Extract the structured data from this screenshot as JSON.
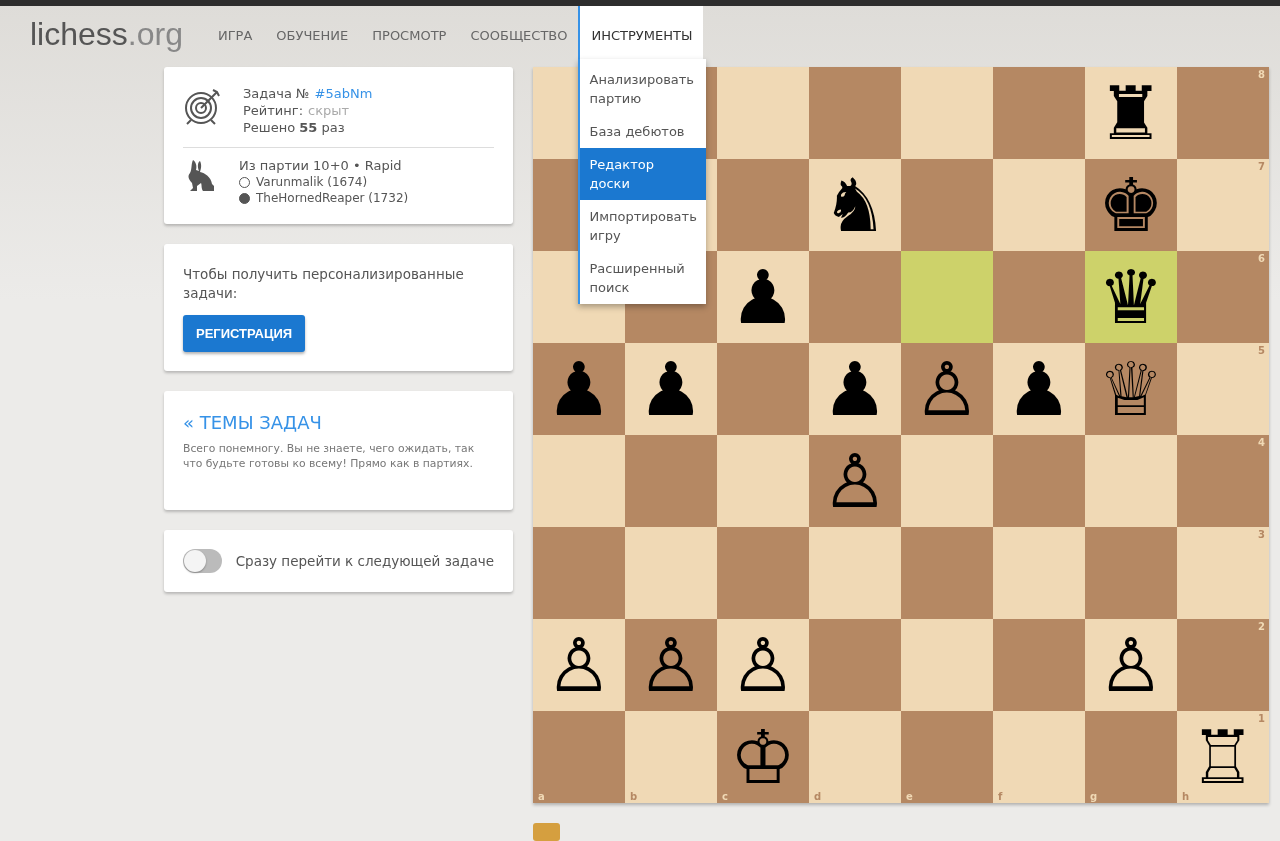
{
  "header": {
    "logo": {
      "name": "lichess",
      "suffix": ".org"
    },
    "nav": [
      {
        "label": "ИГРА",
        "selected": false
      },
      {
        "label": "ОБУЧЕНИЕ",
        "selected": false
      },
      {
        "label": "ПРОСМОТР",
        "selected": false
      },
      {
        "label": "СООБЩЕСТВО",
        "selected": false
      },
      {
        "label": "ИНСТРУМЕНТЫ",
        "selected": true
      }
    ],
    "menu": [
      {
        "label": "Анализировать партию",
        "selected": false
      },
      {
        "label": "База дебютов",
        "selected": false
      },
      {
        "label": "Редактор доски",
        "selected": true
      },
      {
        "label": "Импортировать игру",
        "selected": false
      },
      {
        "label": "Расширенный поиск",
        "selected": false
      }
    ]
  },
  "puzzle": {
    "title": "Задача №",
    "id": "#5abNm",
    "rating_label": "Рейтинг:",
    "rating": "скрыт",
    "solved": "Решено **55** раз",
    "game": "Из партии 10+0 • Rapid",
    "players": [
      {
        "name": "Varunmalik (1674)",
        "kind": "white"
      },
      {
        "name": "TheHornedReaper (1732)",
        "kind": "black"
      }
    ]
  },
  "signup": {
    "text": "Чтобы получить персонализированные задачи:",
    "button": "РЕГИСТРАЦИЯ"
  },
  "themes": {
    "link": "« ТЕМЫ ЗАДАЧ",
    "text": "Всего понемногу. Вы не знаете, чего ожидать, так что будьте готовы ко всему! Прямо как в партиях."
  },
  "auto_next": {
    "label": "Сразу перейти к следующей задаче",
    "on": false
  },
  "board": {
    "files": [
      "a",
      "b",
      "c",
      "d",
      "e",
      "f",
      "g",
      "h"
    ],
    "ranks": [
      "8",
      "7",
      "6",
      "5",
      "4",
      "3",
      "2",
      "1"
    ],
    "rows": [
      [
        {
          "highlighted": false
        },
        {},
        {
          "highlighted": false
        },
        {
          "highlighted": false
        },
        {
          "highlighted": false
        },
        {
          "highlighted": false
        },
        {
          "piece": "♜",
          "highlighted": false
        },
        {
          "highlighted": false
        }
      ],
      [
        {
          "highlighted": false
        },
        {},
        {
          "highlighted": false
        },
        {
          "piece": "♞",
          "highlighted": false
        },
        {
          "highlighted": false
        },
        {
          "highlighted": false
        },
        {
          "piece": "♚",
          "highlighted": false
        },
        {
          "highlighted": false
        }
      ],
      [
        {
          "highlighted": false
        },
        {
          "highlighted": false
        },
        {
          "piece": "♟",
          "highlighted": false
        },
        {
          "highlighted": false
        },
        {
          "highlighted": true
        },
        {
          "highlighted": false
        },
        {
          "piece": "♛",
          "highlighted": true
        },
        {
          "highlighted": false
        }
      ],
      [
        {
          "piece": "♟",
          "highlighted": false
        },
        {
          "piece": "♟",
          "highlighted": false
        },
        {
          "highlighted": false
        },
        {
          "piece": "♟",
          "highlighted": false
        },
        {
          "piece": "♙",
          "highlighted": false
        },
        {
          "piece": "♟",
          "highlighted": false
        },
        {
          "piece": "♕",
          "highlighted": false
        },
        {
          "highlighted": false
        }
      ],
      [
        {
          "highlighted": false
        },
        {
          "highlighted": false
        },
        {
          "highlighted": false
        },
        {
          "piece": "♙",
          "highlighted": false
        },
        {
          "highlighted": false
        },
        {
          "highlighted": false
        },
        {
          "highlighted": false
        },
        {
          "highlighted": false
        }
      ],
      [
        {
          "highlighted": false
        },
        {
          "highlighted": false
        },
        {
          "highlighted": false
        },
        {
          "highlighted": false
        },
        {
          "highlighted": false
        },
        {
          "highlighted": false
        },
        {
          "highlighted": false
        },
        {
          "highlighted": false
        }
      ],
      [
        {
          "piece": "♙",
          "highlighted": false
        },
        {
          "piece": "♙",
          "highlighted": false
        },
        {
          "piece": "♙",
          "highlighted": false
        },
        {
          "highlighted": false
        },
        {
          "highlighted": false
        },
        {
          "highlighted": false
        },
        {
          "piece": "♙",
          "highlighted": false
        },
        {
          "highlighted": false
        }
      ],
      [
        {
          "highlighted": false
        },
        {
          "highlighted": false
        },
        {
          "piece": "♔",
          "highlighted": false
        },
        {
          "highlighted": false
        },
        {
          "highlighted": false
        },
        {
          "highlighted": false
        },
        {
          "highlighted": false
        },
        {
          "piece": "♖",
          "highlighted": false
        }
      ]
    ]
  },
  "swatch": {
    "color": "#d59f3f"
  }
}
